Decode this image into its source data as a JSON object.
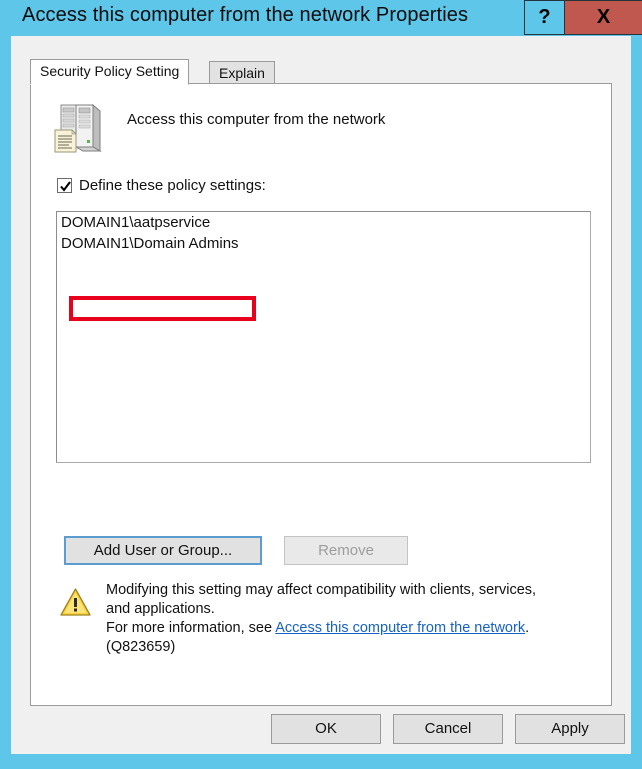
{
  "window": {
    "title": "Access this computer from the network Properties",
    "help_label": "?",
    "close_label": "X",
    "frame_color": "#5ec6e8",
    "close_color": "#c1584f"
  },
  "tabs": [
    {
      "label": "Security Policy Setting",
      "active": true
    },
    {
      "label": "Explain",
      "active": false
    }
  ],
  "policy": {
    "icon": "server-policy-icon",
    "name": "Access this computer from the network"
  },
  "define": {
    "label": "Define these policy settings:",
    "checked": true
  },
  "list": {
    "items": [
      "DOMAIN1\\aatpservice",
      "DOMAIN1\\Domain Admins"
    ]
  },
  "annotation": {
    "color": "#e8001c",
    "target": "DOMAIN1\\aatpservice"
  },
  "buttons": {
    "add_user_or_group": "Add User or Group...",
    "remove": "Remove",
    "remove_disabled": true,
    "add_focused": true
  },
  "warning": {
    "icon": "warning-triangle-icon",
    "line1": "Modifying this setting may affect compatibility with clients, services,",
    "line2": "and applications.",
    "line3_prefix": "For more information, see ",
    "link": "Access this computer from the network",
    "line3_suffix": ".",
    "line4": "(Q823659)",
    "link_color": "#1661c6"
  },
  "commands": {
    "ok": "OK",
    "cancel": "Cancel",
    "apply": "Apply"
  }
}
